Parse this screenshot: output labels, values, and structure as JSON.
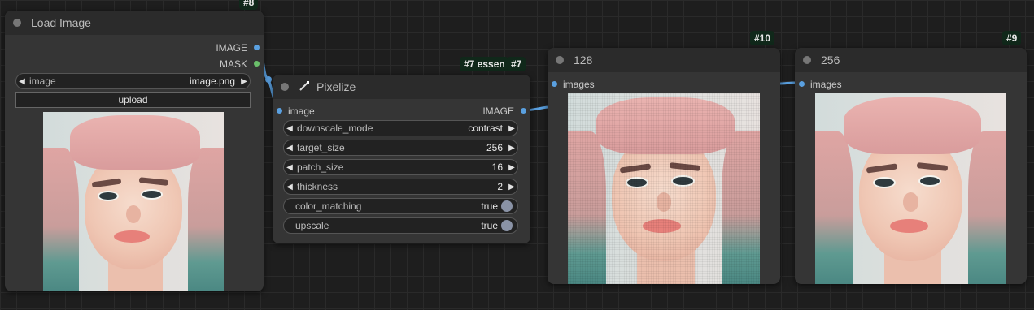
{
  "nodes": {
    "load_image": {
      "title": "Load Image",
      "badge": "#8",
      "outputs": [
        "IMAGE",
        "MASK"
      ],
      "image_widget": {
        "name": "image",
        "value": "image.png"
      },
      "upload_label": "upload"
    },
    "pixelize": {
      "title": "Pixelize",
      "badge_text": "#7 essen",
      "badge_id": "#7",
      "input_label": "image",
      "output_label": "IMAGE",
      "widgets": [
        {
          "name": "downscale_mode",
          "value": "contrast"
        },
        {
          "name": "target_size",
          "value": "256"
        },
        {
          "name": "patch_size",
          "value": "16"
        },
        {
          "name": "thickness",
          "value": "2"
        }
      ],
      "toggles": [
        {
          "name": "color_matching",
          "value": "true"
        },
        {
          "name": "upscale",
          "value": "true"
        }
      ]
    },
    "preview_128": {
      "title": "128",
      "badge": "#10",
      "input_label": "images"
    },
    "preview_256": {
      "title": "256",
      "badge": "#9",
      "input_label": "images"
    }
  },
  "colors": {
    "image_link": "#5aa0e0",
    "mask_slot": "#6bbf6b",
    "badge_bg": "#10281a"
  },
  "icons": {
    "pixelize_title_icon": "wand-icon",
    "left_arrow": "triangle-left",
    "right_arrow": "triangle-right"
  }
}
